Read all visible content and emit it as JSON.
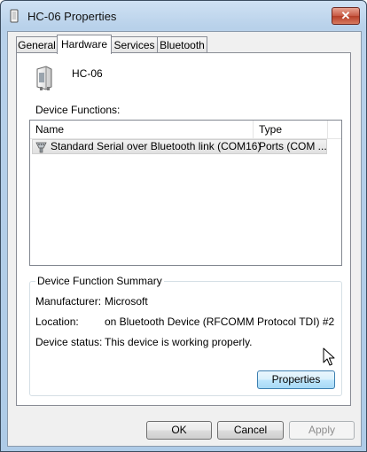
{
  "window": {
    "title": "HC-06 Properties",
    "close_glyph": "✕"
  },
  "tabs": [
    {
      "label": "General",
      "active": false
    },
    {
      "label": "Hardware",
      "active": true
    },
    {
      "label": "Services",
      "active": false
    },
    {
      "label": "Bluetooth",
      "active": false
    }
  ],
  "device": {
    "name": "HC-06",
    "icon": "bluetooth-device-icon"
  },
  "functions": {
    "label": "Device Functions:",
    "columns": [
      "Name",
      "Type"
    ],
    "rows": [
      {
        "name": "Standard Serial over Bluetooth link (COM16)",
        "type": "Ports (COM ...",
        "icon": "serial-port-icon",
        "selected": true
      }
    ]
  },
  "summary": {
    "legend": "Device Function Summary",
    "manufacturer_label": "Manufacturer:",
    "manufacturer": "Microsoft",
    "location_label": "Location:",
    "location": "on Bluetooth Device (RFCOMM Protocol TDI) #2",
    "status_label": "Device status:",
    "status": "This device is working properly.",
    "properties_button": "Properties"
  },
  "footer": {
    "ok": "OK",
    "cancel": "Cancel",
    "apply": "Apply"
  }
}
